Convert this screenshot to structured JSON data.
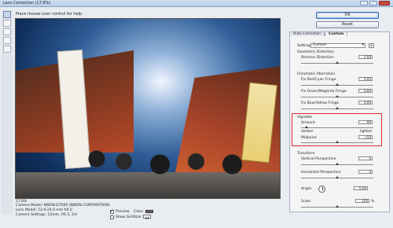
{
  "window": {
    "title": "Lens Correction (17.8%)"
  },
  "hint": "Place mouse over control for help",
  "tools": [
    "remove-distortion-tool",
    "straighten-tool",
    "move-grid-tool",
    "hand-tool",
    "zoom-tool"
  ],
  "buttons": {
    "ok": "OK",
    "reset": "Reset"
  },
  "tabs": {
    "auto": "Auto Correction",
    "custom": "Custom"
  },
  "settings": {
    "label": "Settings:",
    "value": "Custom"
  },
  "geometric": {
    "header": "Geometric Distortion",
    "remove_distortion": "Remove Distortion",
    "remove_distortion_value": "0.00"
  },
  "chromatic": {
    "header": "Chromatic Aberration",
    "red_cyan": "Fix Red/Cyan Fringe",
    "red_cyan_value": "0.00",
    "green_magenta": "Fix Green/Magenta Fringe",
    "green_magenta_value": "0.00",
    "blue_yellow": "Fix Blue/Yellow Fringe",
    "blue_yellow_value": "0.00"
  },
  "vignette": {
    "header": "Vignette",
    "amount": "Amount",
    "amount_value": "-90",
    "darken": "darken",
    "lighten": "lighten",
    "midpoint": "Midpoint",
    "midpoint_value": "+50"
  },
  "transform": {
    "header": "Transform",
    "vertical": "Vertical Perspective",
    "vertical_value": "0",
    "horizontal": "Horizontal Perspective",
    "horizontal_value": "0",
    "angle": "Angle:",
    "angle_value": "0.00",
    "scale": "Scale",
    "scale_value": "100",
    "scale_unit": "%"
  },
  "zoom": "17.8%",
  "camera": {
    "model": "Camera Model: NIKON D7000 (NIKON CORPORATION)",
    "lens": "Lens Model: 12.0-24.0 mm f/4.0",
    "settings": "Camera Settings: 12mm, f/6.3, 2m"
  },
  "preview": {
    "preview": "Preview",
    "show_grid": "Show Grid"
  },
  "grid": {
    "color": "Color:",
    "size": "Size:",
    "size_value": "64"
  }
}
